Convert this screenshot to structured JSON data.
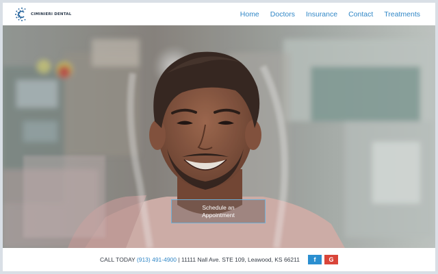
{
  "header": {
    "logo_text": "CIMINIERI DENTAL",
    "nav": [
      {
        "label": "Home"
      },
      {
        "label": "Doctors"
      },
      {
        "label": "Insurance"
      },
      {
        "label": "Contact"
      },
      {
        "label": "Treatments"
      }
    ]
  },
  "hero": {
    "cta_label": "Schedule an Appointment",
    "background_image": "smiling-young-man-photo"
  },
  "footer": {
    "call_label": "CALL TODAY",
    "phone": "(913) 491-4900",
    "separator": "|",
    "address": "11111 Nall Ave. STE 109, Leawood, KS 66211",
    "social": [
      {
        "icon": "facebook-icon",
        "glyph": "f"
      },
      {
        "icon": "google-icon",
        "glyph": "G"
      }
    ]
  },
  "colors": {
    "accent": "#2f86c6",
    "facebook": "#2b8fd0",
    "google": "#d9453a"
  }
}
